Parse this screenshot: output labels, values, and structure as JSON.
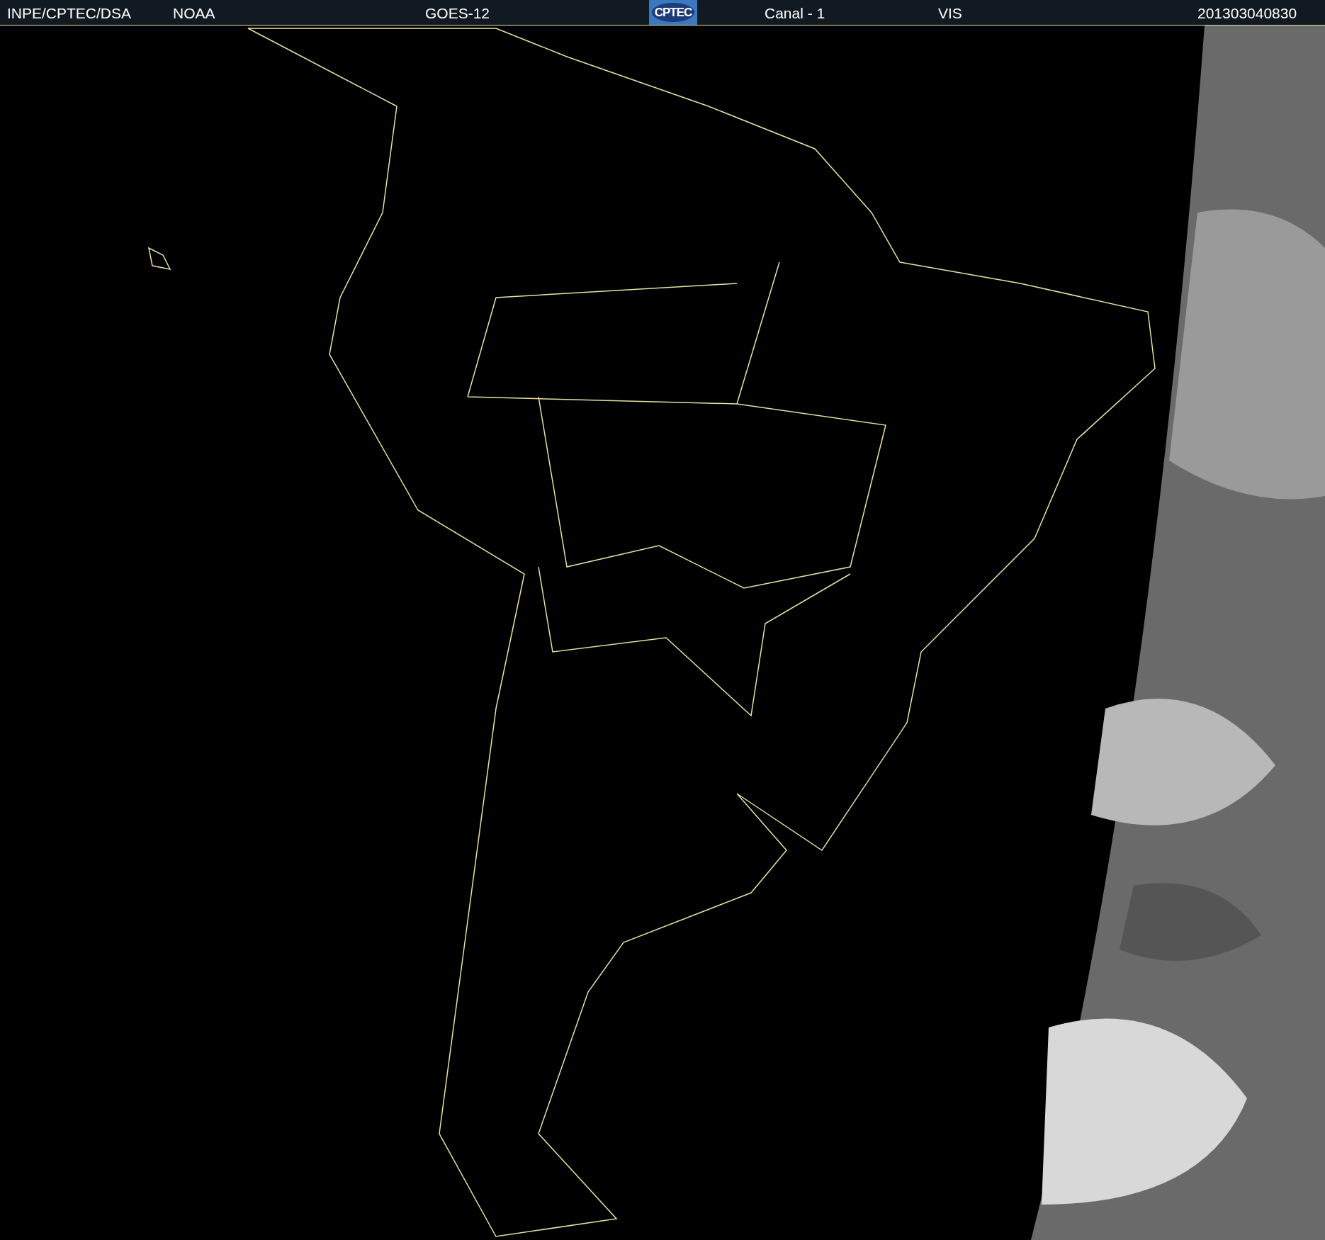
{
  "header": {
    "items": [
      {
        "kind": "text",
        "text": "INPE/CPTEC/DSA"
      },
      {
        "kind": "text",
        "text": "NOAA"
      },
      {
        "kind": "text",
        "text": "GOES-12"
      },
      {
        "kind": "logo",
        "text": "CPTEC"
      },
      {
        "kind": "text",
        "text": "Canal - 1"
      },
      {
        "kind": "text",
        "text": "VIS"
      },
      {
        "kind": "text",
        "text": "201303040830"
      }
    ]
  }
}
